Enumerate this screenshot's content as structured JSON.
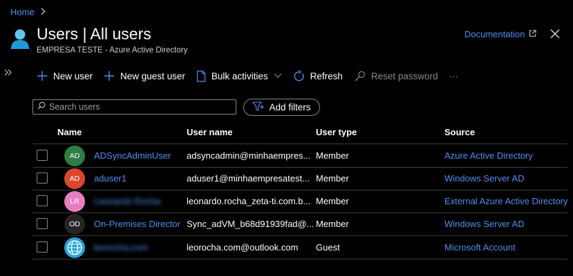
{
  "breadcrumb": {
    "home_label": "Home"
  },
  "header": {
    "title": "Users | All users",
    "subtitle": "EMPRESA TESTE - Azure Active Directory",
    "doc_link_label": "Documentation"
  },
  "toolbar": {
    "new_user_label": "New user",
    "new_guest_user_label": "New guest user",
    "bulk_activities_label": "Bulk activities",
    "refresh_label": "Refresh",
    "reset_password_label": "Reset password",
    "more_label": "···"
  },
  "search": {
    "placeholder": "Search users"
  },
  "filters": {
    "add_filters_label": "Add filters"
  },
  "table": {
    "columns": {
      "name": "Name",
      "user_name": "User name",
      "user_type": "User type",
      "source": "Source"
    },
    "rows": [
      {
        "initials": "AD",
        "avatar_color": "#2d7d45",
        "name": "ADSyncAdminUser",
        "user_name": "adsyncadmin@minhaempres...",
        "user_type": "Member",
        "source": "Azure Active Directory"
      },
      {
        "initials": "AD",
        "avatar_color": "#d9482b",
        "name": "aduser1",
        "user_name": "aduser1@minhaempresatest...",
        "user_type": "Member",
        "source": "Windows Server AD"
      },
      {
        "initials": "LR",
        "avatar_color": "#e87ec0",
        "name": "Leonardo Rocha",
        "user_name": "leonardo.rocha_zeta-ti.com.b...",
        "user_type": "Member",
        "source": "External Azure Active Directory"
      },
      {
        "initials": "OD",
        "avatar_color": "#252423",
        "name": "On-Premises Director",
        "user_name": "Sync_adVM_b68d91939fad@...",
        "user_type": "Member",
        "source": "Windows Server AD"
      },
      {
        "initials": "",
        "avatar_color": "#29a3d6",
        "name": "leorocha.com",
        "user_name": "leorocha.com@outlook.com",
        "user_type": "Guest",
        "source": "Microsoft Account"
      }
    ]
  },
  "colors": {
    "accent": "#4f8ff0",
    "background": "#000000",
    "border": "#8a8886",
    "divider": "#3b3a39"
  }
}
